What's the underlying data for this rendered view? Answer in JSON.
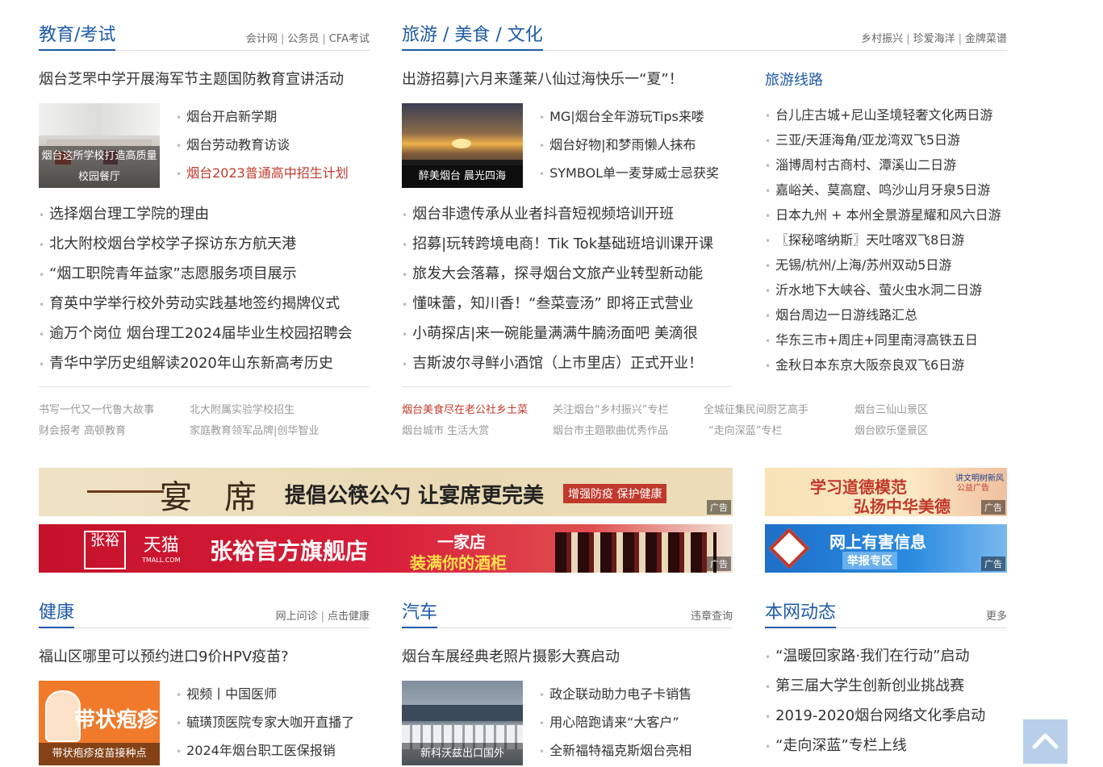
{
  "education": {
    "title": "教育/考试",
    "links": [
      "会计网",
      "公务员",
      "CFA考试"
    ],
    "headline": "烟台芝罘中学开展海军节主题国防教育宣讲活动",
    "thumb_caption": "烟台这所学校打造高质量校园餐厅",
    "side_items": [
      "烟台开启新学期",
      "烟台劳动教育访谈",
      "烟台2023普通高中招生计划"
    ],
    "list": [
      "选择烟台理工学院的理由",
      "北大附校烟台学校学子探访东方航天港",
      "“烟工职院青年益家”志愿服务项目展示",
      "育英中学举行校外劳动实践基地签约揭牌仪式",
      "逾万个岗位 烟台理工2024届毕业生校园招聘会",
      "青华中学历史组解读2020年山东新高考历史"
    ],
    "small_links": [
      "书写一代又一代鲁大故事",
      "北大附属实验学校招生",
      "财会报考 高顿教育",
      "家庭教育领军品牌|创华智业"
    ]
  },
  "travel": {
    "title": "旅游 / 美食 / 文化",
    "links": [
      "乡村振兴",
      "珍爱海洋",
      "金牌菜谱"
    ],
    "headline": "出游招募|六月来蓬莱八仙过海快乐一“夏”！",
    "thumb_caption": "醉美烟台 晨光四海",
    "side_items": [
      "MG|烟台全年游玩Tips来喽",
      "烟台好物|和梦雨懒人抹布",
      "SYMBOL单一麦芽威士忌获奖"
    ],
    "list": [
      "烟台非遗传承从业者抖音短视频培训开班",
      "招募|玩转跨境电商！Tik Tok基础班培训课开课",
      "旅发大会落幕，探寻烟台文旅产业转型新动能",
      "懂味蕾，知川香！“叁菜壹汤” 即将正式营业",
      "小萌探店|来一碗能量满满牛腩汤面吧 美滴很",
      "吉斯波尔寻鲜小酒馆（上市里店）正式开业！"
    ],
    "small_links": [
      "烟台美食尽在老公社乡土菜",
      "关注烟台“乡村振兴”专栏",
      "全城征集民间厨艺高手",
      "烟台三仙山景区",
      "烟台城市 生活大赏",
      "烟台市主题歌曲优秀作品",
      "“走向深蓝”专栏",
      "烟台欧乐堡景区"
    ]
  },
  "routes": {
    "title": "旅游线路",
    "items": [
      "台儿庄古城+尼山圣境轻奢文化两日游",
      "三亚/天涯海角/亚龙湾双飞5日游",
      "淄博周村古商村、潭溪山二日游",
      "嘉峪关、莫高窟、鸣沙山月牙泉5日游",
      "日本九州 + 本州全景游星耀和风六日游",
      "〖探秘喀纳斯〗天吐喀双飞8日游",
      "无锡/杭州/上海/苏州双动5日游",
      "沂水地下大峡谷、萤火虫水洞二日游",
      "烟台周边一日游线路汇总",
      "华东三市+周庄+同里南浔高铁五日",
      "金秋日本东京大阪奈良双飞6日游"
    ]
  },
  "ads": {
    "tag": "广告",
    "banner1": {
      "brand": "宴席",
      "slogan": "提倡公筷公勺 让宴席更完美",
      "badge": "增强防疫 保护健康"
    },
    "banner2": {
      "brand1": "张裕",
      "brand2": "天猫",
      "brand2_sub": "TMALL.COM",
      "slogan": "张裕官方旗舰店",
      "sub1": "一家店",
      "sub2": "装满你的酒柜"
    },
    "side1": {
      "line1": "学习道德模范",
      "line2": "弘扬中华美德",
      "corner": "讲文明树新风",
      "corner2": "公益广告"
    },
    "side2": {
      "line1": "网上有害信息",
      "line2": "举报专区"
    }
  },
  "health": {
    "title": "健康",
    "links": [
      "网上问诊",
      "点击健康"
    ],
    "headline": "福山区哪里可以预约进口9价HPV疫苗?",
    "thumb_caption": "带状疱疹疫苗接种点",
    "thumb_text": "带状疱疹",
    "side_items": [
      "视频丨中国医师",
      "毓璜顶医院专家大咖开直播了",
      "2024年烟台职工医保报销"
    ]
  },
  "auto": {
    "title": "汽车",
    "links": [
      "违章查询"
    ],
    "headline": "烟台车展经典老照片摄影大赛启动",
    "thumb_caption": "新科沃兹出口国外",
    "side_items": [
      "政企联动助力电子卡销售",
      "用心陪跑请来“大客户”",
      "全新福特福克斯烟台亮相"
    ]
  },
  "news": {
    "title": "本网动态",
    "more": "更多",
    "items": [
      "“温暖回家路·我们在行动”启动",
      "第三届大学生创新创业挑战赛",
      "2019-2020烟台网络文化季启动",
      "“走向深蓝”专栏上线"
    ]
  },
  "colors": {
    "accent": "#1e5aa8",
    "highlight": "#c0392b"
  },
  "icons": {
    "back_to_top": "chevron-up-icon"
  }
}
